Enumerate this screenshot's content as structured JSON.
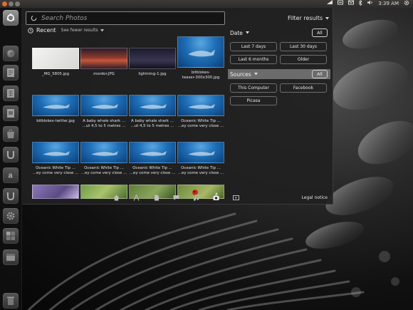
{
  "top_panel": {
    "time": "3:39 AM"
  },
  "dash": {
    "search_placeholder": "Search Photos",
    "filter_results_label": "Filter results",
    "recent_label": "Recent",
    "see_fewer_label": "See fewer results",
    "legal_notice": "Legal notice"
  },
  "photos": [
    {
      "caption": "_MG_5805.jpg",
      "style": "white"
    },
    {
      "caption": "mordor.JPG",
      "style": "sunset"
    },
    {
      "caption": "lightning-1.jpg",
      "style": "night"
    },
    {
      "caption": "bitblokes-",
      "caption2": "teaser-300x300.jpg",
      "style": "ocean"
    },
    {
      "caption": "bitblokes-twitter.jpg",
      "style": "ocean"
    },
    {
      "caption": "A baby whale shark ...",
      "caption2": "...ut 4,5 to 5 metres ...",
      "style": "ocean"
    },
    {
      "caption": "A baby whale shark ...",
      "caption2": "...ut 4,5 to 5 metres ...",
      "style": "ocean"
    },
    {
      "caption": "Oceanic White Tip ...",
      "caption2": "...ey come very close ...",
      "style": "ocean"
    },
    {
      "caption": "Oceanic White Tip ...",
      "caption2": "...ey come very close ...",
      "style": "ocean"
    },
    {
      "caption": "Oceanic White Tip ...",
      "caption2": "...ey come very close ...",
      "style": "ocean"
    },
    {
      "caption": "Oceanic White Tip ...",
      "caption2": "...ey come very close ...",
      "style": "ocean"
    },
    {
      "caption": "Oceanic White Tip ...",
      "caption2": "...ey come very close ...",
      "style": "ocean"
    },
    {
      "caption": "",
      "style": "flower"
    },
    {
      "caption": "",
      "style": "green"
    },
    {
      "caption": "",
      "style": "leaf"
    },
    {
      "caption": "",
      "style": "ladybug"
    }
  ],
  "filters": {
    "date": {
      "label": "Date",
      "all_label": "All",
      "options": [
        "Last 7 days",
        "Last 30 days",
        "Last 6 months",
        "Older"
      ]
    },
    "sources": {
      "label": "Sources",
      "all_label": "All",
      "options": [
        "This Computer",
        "Facebook",
        "Picasa"
      ]
    }
  },
  "lenses": [
    {
      "name": "home"
    },
    {
      "name": "applications"
    },
    {
      "name": "files"
    },
    {
      "name": "social"
    },
    {
      "name": "music"
    },
    {
      "name": "photos",
      "active": true
    },
    {
      "name": "video"
    }
  ],
  "colors": {
    "close_button": "#e4683a",
    "dash_background": "#202020",
    "ocean_blue": "#1e6fb8"
  }
}
